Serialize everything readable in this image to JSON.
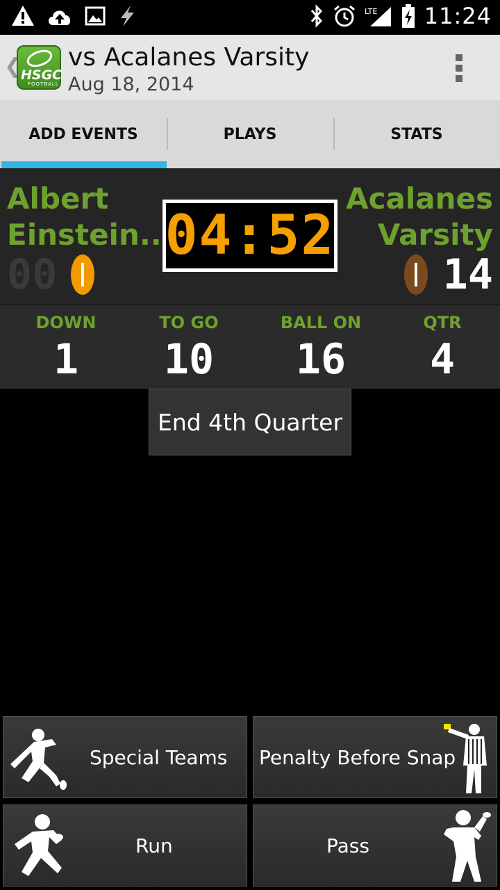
{
  "status_bar": {
    "time": "11:24"
  },
  "action_bar": {
    "title": "vs Acalanes Varsity",
    "subtitle": "Aug 18, 2014",
    "logo_text": "HSGC",
    "logo_subtext": "FOOTBALL"
  },
  "tabs": [
    {
      "label": "ADD EVENTS",
      "active": true
    },
    {
      "label": "PLAYS",
      "active": false
    },
    {
      "label": "STATS",
      "active": false
    }
  ],
  "scoreboard": {
    "home_team": "Albert Einstein...",
    "away_team": "Acalanes Varsity",
    "clock": "04:52",
    "home_score": "00",
    "away_score": "14",
    "possession": "home",
    "accent_color": "#6ea22e",
    "clock_color": "#f5a000"
  },
  "game_state": {
    "down_label": "DOWN",
    "down": "1",
    "togo_label": "TO GO",
    "togo": "10",
    "ballon_label": "BALL ON",
    "ballon": "16",
    "qtr_label": "QTR",
    "qtr": "4"
  },
  "end_quarter_button": "End 4th Quarter",
  "event_buttons": {
    "special_teams": "Special Teams",
    "penalty": "Penalty Before Snap",
    "run": "Run",
    "pass": "Pass"
  },
  "icons": [
    "warning-icon",
    "upload-cloud-icon",
    "image-icon",
    "flash-icon",
    "bluetooth-icon",
    "alarm-icon",
    "lte-signal-icon",
    "battery-icon"
  ]
}
